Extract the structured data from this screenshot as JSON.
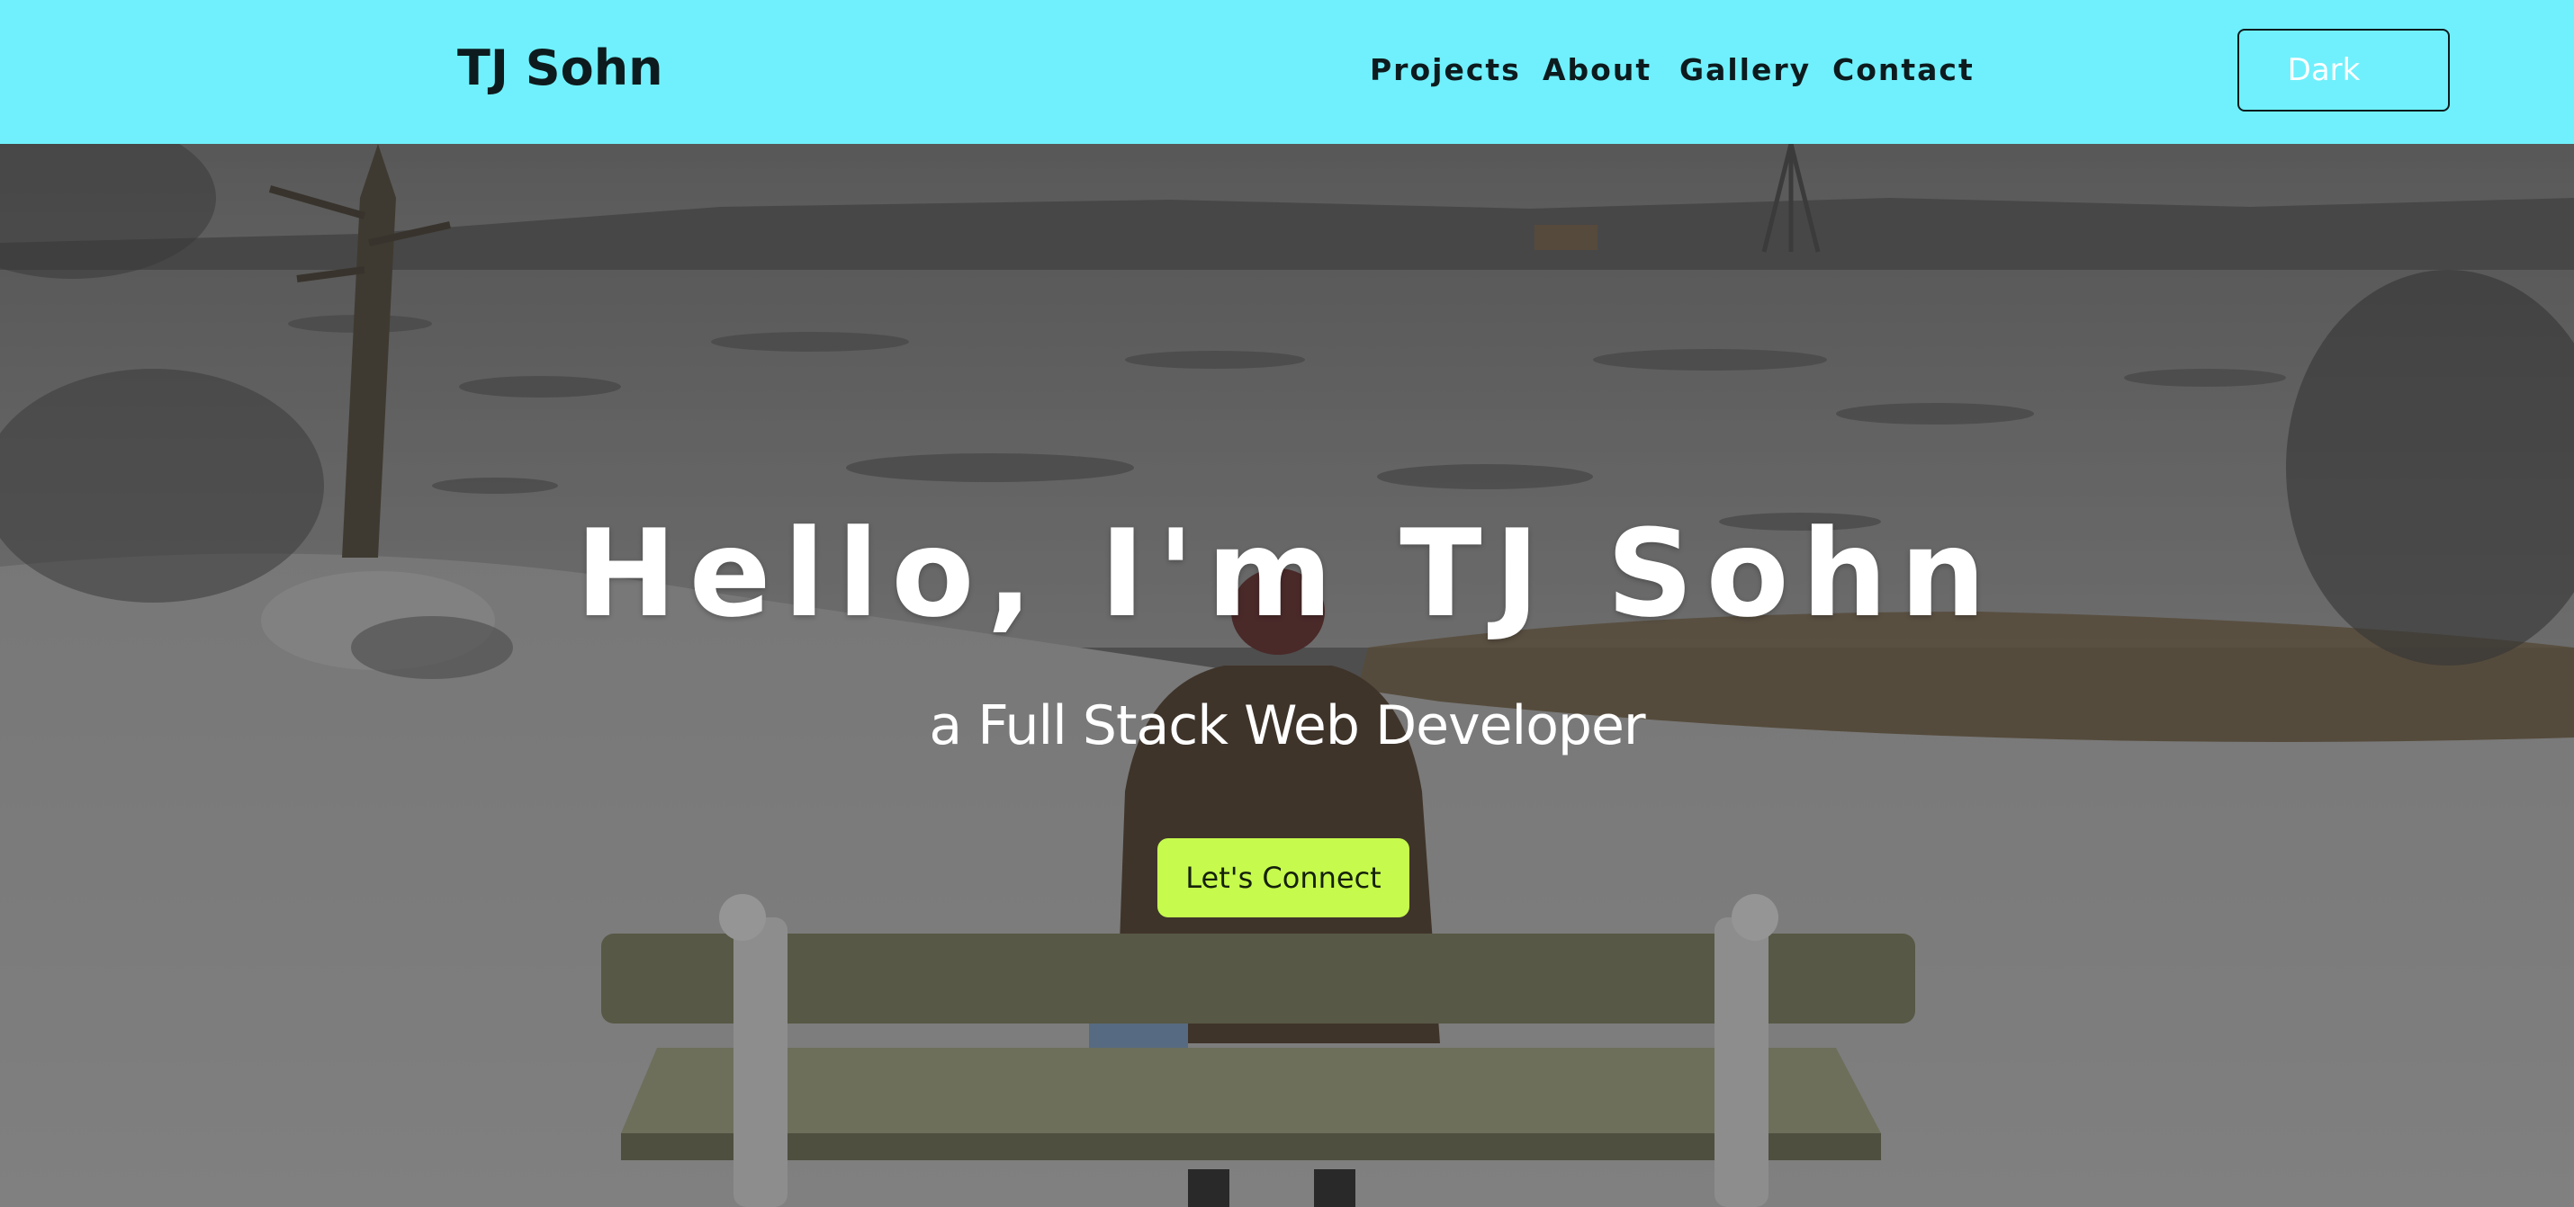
{
  "header": {
    "brand": "TJ Sohn",
    "nav": [
      {
        "label": "Projects"
      },
      {
        "label": "About"
      },
      {
        "label": "Gallery"
      },
      {
        "label": "Contact"
      }
    ],
    "theme_toggle": {
      "label": "Dark",
      "icon": "moon-icon"
    }
  },
  "hero": {
    "title": "Hello, I'm TJ Sohn",
    "subtitle": "a Full Stack Web Developer",
    "cta_label": "Let's Connect",
    "background": "photo: person in red hat sitting on a bench facing a frozen snowy lake"
  },
  "colors": {
    "header_bg": "#70f0fc",
    "cta_bg": "#c6fb4e",
    "text_dark": "#0d1b1e",
    "text_light": "#ffffff"
  }
}
